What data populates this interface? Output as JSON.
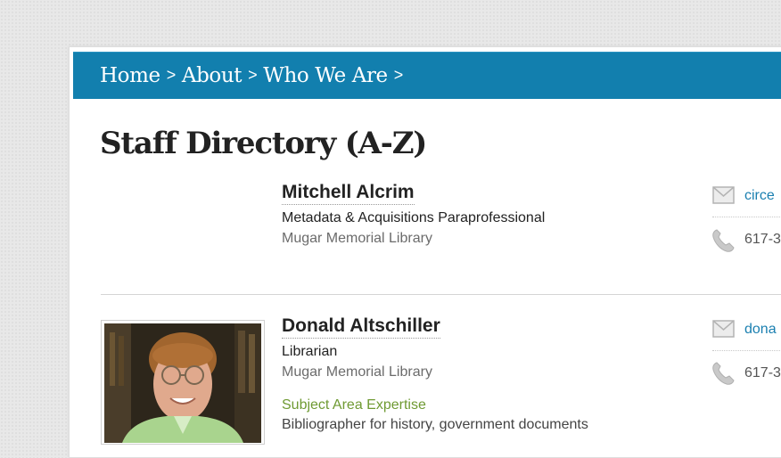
{
  "breadcrumb": {
    "items": [
      "Home",
      "About",
      "Who We Are"
    ],
    "separator": ">"
  },
  "page": {
    "title": "Staff Directory (A-Z)"
  },
  "staff": [
    {
      "name": "Mitchell Alcrim",
      "title": "Metadata & Acquisitions Paraprofessional",
      "department": "Mugar Memorial Library",
      "email": "circe",
      "phone": "617-3"
    },
    {
      "name": "Donald Altschiller",
      "title": "Librarian",
      "department": "Mugar Memorial Library",
      "expertise_heading": "Subject Area Expertise",
      "expertise": "Bibliographer for history, government documents",
      "email": "dona",
      "phone": "617-3"
    }
  ],
  "icons": {
    "email": "mail-icon",
    "phone": "phone-icon"
  },
  "colors": {
    "header_blue": "#127fae",
    "link_blue": "#1a7fb0",
    "expertise_green": "#6f9a33",
    "text_dark": "#222222"
  }
}
